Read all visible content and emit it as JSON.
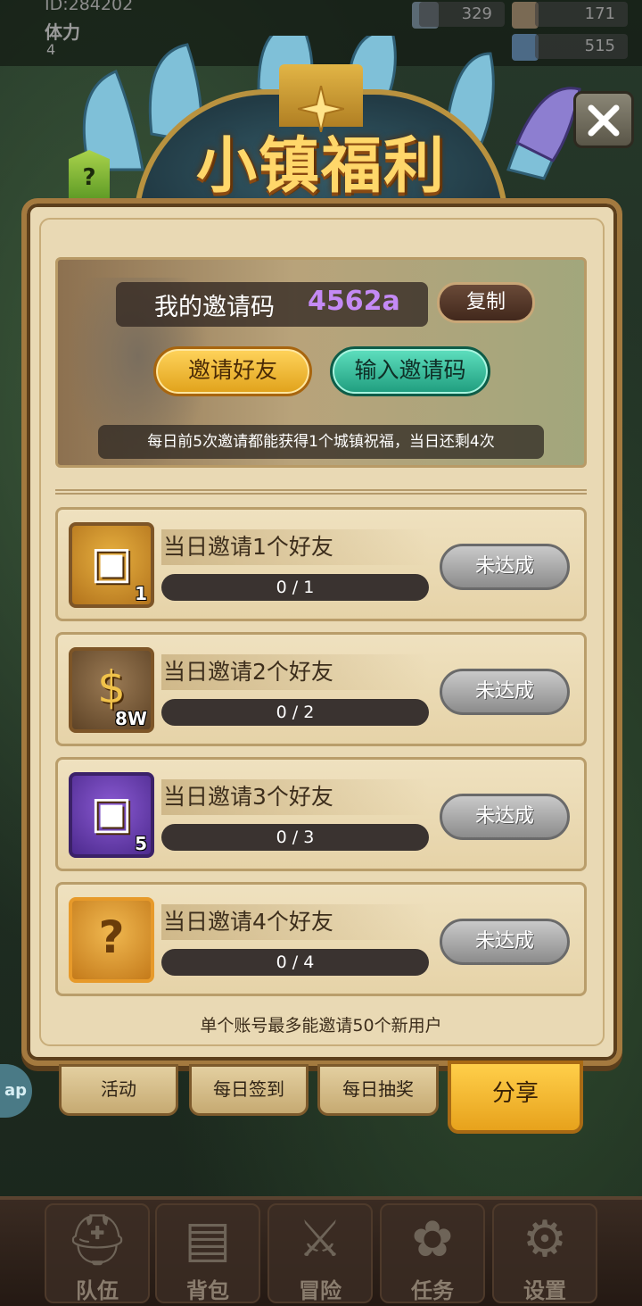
{
  "topbar": {
    "player_id": "ID:284202",
    "stamina_label": "体力",
    "stamina_value": "4",
    "resource_1": "329",
    "resource_2": "171",
    "resource_3": "515"
  },
  "header": {
    "title": "小镇福利",
    "help_label": "?",
    "close_icon": "close-icon"
  },
  "invite": {
    "code_label": "我的邀请码",
    "code_value": "4562a",
    "copy_label": "复制",
    "invite_friend_label": "邀请好友",
    "enter_code_label": "输入邀请码",
    "note": "每日前5次邀请都能获得1个城镇祝福，当日还剩4次"
  },
  "tasks": [
    {
      "title": "当日邀请1个好友",
      "progress_text": "0 / 1",
      "progress": 0,
      "reward_icon": "chest-icon",
      "reward_count": "1",
      "status": "未达成"
    },
    {
      "title": "当日邀请2个好友",
      "progress_text": "0 / 2",
      "progress": 0,
      "reward_icon": "gold-bag-icon",
      "reward_count": "8W",
      "status": "未达成"
    },
    {
      "title": "当日邀请3个好友",
      "progress_text": "0 / 3",
      "progress": 0,
      "reward_icon": "chest-icon",
      "reward_count": "5",
      "status": "未达成"
    },
    {
      "title": "当日邀请4个好友",
      "progress_text": "0 / 4",
      "progress": 0,
      "reward_icon": "mystery-icon",
      "reward_count": "",
      "status": "未达成"
    }
  ],
  "footer_note": "单个账号最多能邀请50个新用户",
  "tabs": [
    {
      "label": "活动",
      "active": false
    },
    {
      "label": "每日签到",
      "active": false
    },
    {
      "label": "每日抽奖",
      "active": false
    },
    {
      "label": "分享",
      "active": true
    }
  ],
  "side_bubble": "ap",
  "bottom_nav": [
    {
      "label": "队伍",
      "icon": "helmet-icon"
    },
    {
      "label": "背包",
      "icon": "backpack-icon"
    },
    {
      "label": "冒险",
      "icon": "swords-icon"
    },
    {
      "label": "任务",
      "icon": "scroll-icon"
    },
    {
      "label": "设置",
      "icon": "gear-icon"
    }
  ],
  "colors": {
    "panel_bg": "#e9d9b4",
    "invite_code": "#c48af5",
    "gold_button": "#e0a11a",
    "teal_button": "#1e9c7d",
    "disabled_button": "#8c8c8c",
    "title": "#ffd76a"
  }
}
